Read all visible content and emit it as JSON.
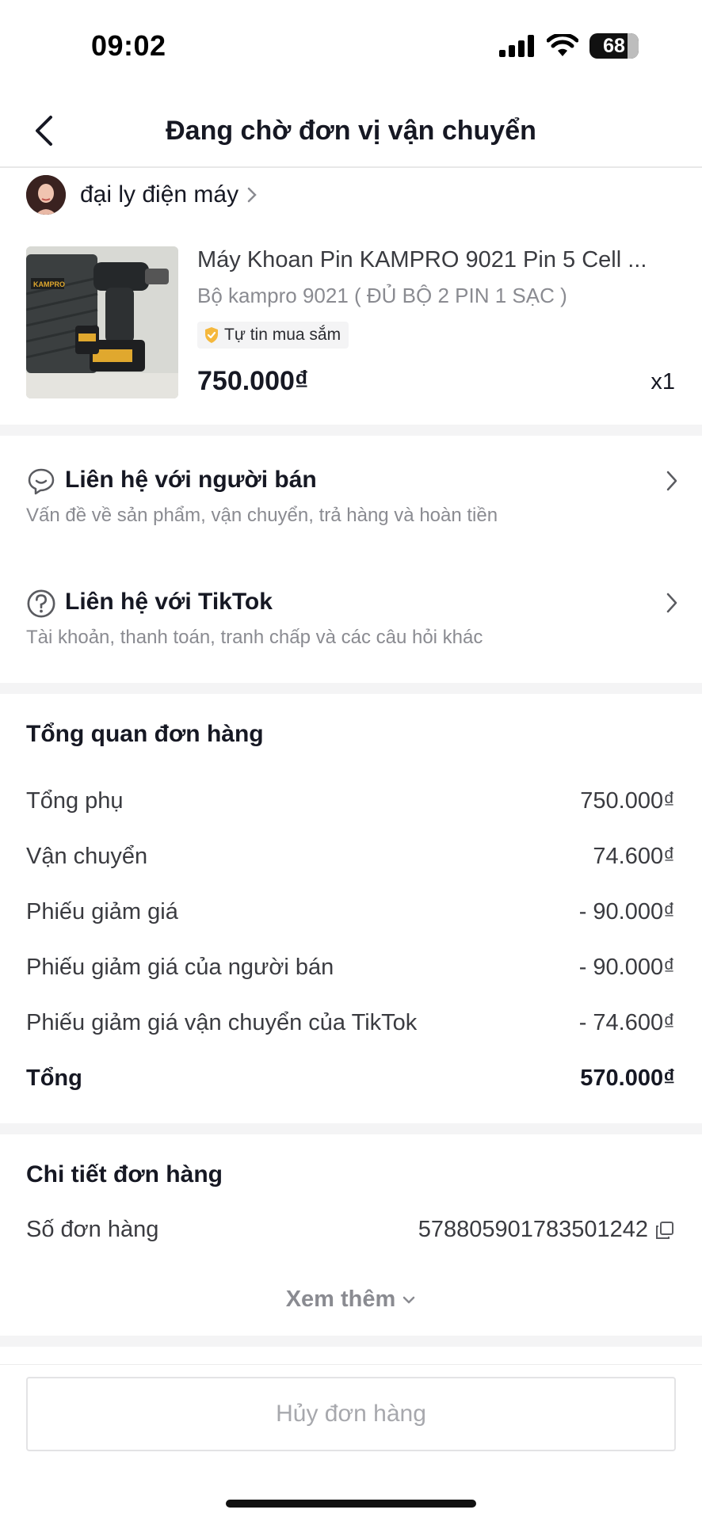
{
  "status_bar": {
    "time": "09:02",
    "battery": "68"
  },
  "nav": {
    "title": "Đang chờ đơn vị vận chuyển",
    "back_icon": "chevron-left-icon"
  },
  "seller": {
    "name": "đại ly điện máy"
  },
  "product": {
    "title": "Máy Khoan Pin KAMPRO 9021 Pin 5 Cell ...",
    "variant": "Bộ kampro 9021 ( ĐỦ BỘ 2 PIN 1 SẠC )",
    "badge": "Tự tin mua sắm",
    "badge_color": "#F5B83D",
    "price": "750.000₫",
    "quantity": "x1",
    "image_brand": "KAMPRO"
  },
  "contact_seller": {
    "title": "Liên hệ với người bán",
    "subtitle": "Vấn đề về sản phẩm, vận chuyển, trả hàng và hoàn tiền"
  },
  "contact_tiktok": {
    "title": "Liên hệ với TikTok",
    "subtitle": "Tài khoản, thanh toán, tranh chấp và các câu hỏi khác"
  },
  "order_summary": {
    "title": "Tổng quan đơn hàng",
    "rows": [
      {
        "label": "Tổng phụ",
        "value": "750.000₫"
      },
      {
        "label": "Vận chuyển",
        "value": "74.600₫"
      },
      {
        "label": "Phiếu giảm giá",
        "value": "- 90.000₫"
      },
      {
        "label": "Phiếu giảm giá của người bán",
        "value": "- 90.000₫"
      },
      {
        "label": "Phiếu giảm giá vận chuyển của TikTok",
        "value": "- 74.600₫"
      }
    ],
    "total": {
      "label": "Tổng",
      "value": "570.000₫"
    }
  },
  "order_details": {
    "title": "Chi tiết đơn hàng",
    "order_number_label": "Số đơn hàng",
    "order_number": "578805901783501242",
    "see_more": "Xem thêm"
  },
  "actions": {
    "cancel_label": "Hủy đơn hàng"
  }
}
